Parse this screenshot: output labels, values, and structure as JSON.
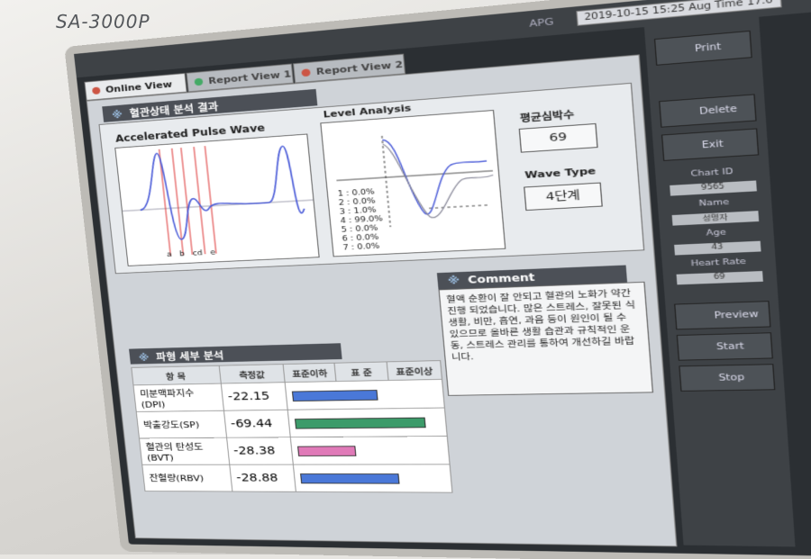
{
  "device": {
    "model": "SA-3000P"
  },
  "topbar": {
    "mode": "APG",
    "datetime": "2019-10-15 15:25 Aug Time 17.0"
  },
  "tabs": [
    {
      "label": "Online View",
      "active": true
    },
    {
      "label": "Report View 1",
      "active": false
    },
    {
      "label": "Report View 2",
      "active": false
    }
  ],
  "result_section": {
    "title": "혈관상태 분석 결과",
    "mark": "※"
  },
  "apw": {
    "title": "Accelerated Pulse Wave",
    "markers": [
      "a",
      "b",
      "c",
      "d",
      "e"
    ]
  },
  "level": {
    "title": "Level Analysis",
    "levels": [
      "1 : 0.0%",
      "2 : 0.0%",
      "3 : 1.0%",
      "4 : 99.0%",
      "5 : 0.0%",
      "6 : 0.0%",
      "7 : 0.0%"
    ]
  },
  "heart_rate": {
    "label": "평균심박수",
    "value": "69"
  },
  "wave_type": {
    "label": "Wave Type",
    "value": "4단계"
  },
  "comment": {
    "title": "Comment",
    "text": "혈액 순환이 잘 안되고 혈관의 노화가 약간 진행 되었습니다. 많은 스트레스, 잘못된 식생활, 비만, 흡연, 과음 등이 원인이 될 수 있으므로 올바른 생활 습관과 규칙적인 운동, 스트레스 관리를 통하여 개선하길 바랍니다."
  },
  "detail_section": {
    "title": "파형 세부 분석",
    "mark": "※",
    "headers": {
      "item": "항 목",
      "value": "측정값",
      "below": "표준이하",
      "standard": "표 준",
      "above": "표준이상"
    },
    "rows": [
      {
        "item": "미분맥파지수(DPI)",
        "value": "-22.15",
        "bar_fraction": 0.62,
        "color": "#4a78d8"
      },
      {
        "item": "박출강도(SP)",
        "value": "-69.44",
        "bar_fraction": 0.95,
        "color": "#3c9b6a"
      },
      {
        "item": "혈관의 탄성도(BVT)",
        "value": "-28.38",
        "bar_fraction": 0.42,
        "color": "#e07ab8"
      },
      {
        "item": "잔혈량(RBV)",
        "value": "-28.88",
        "bar_fraction": 0.72,
        "color": "#4a78d8"
      }
    ]
  },
  "sidebar": {
    "buttons": [
      "Print",
      "Delete",
      "Exit"
    ],
    "fields": [
      {
        "label": "Chart ID",
        "value": "9565"
      },
      {
        "label": "Name",
        "value": "성명자"
      },
      {
        "label": "Age",
        "value": "43"
      },
      {
        "label": "Heart Rate",
        "value": "69"
      }
    ],
    "bottom_buttons": [
      "Preview",
      "Start",
      "Stop"
    ]
  }
}
